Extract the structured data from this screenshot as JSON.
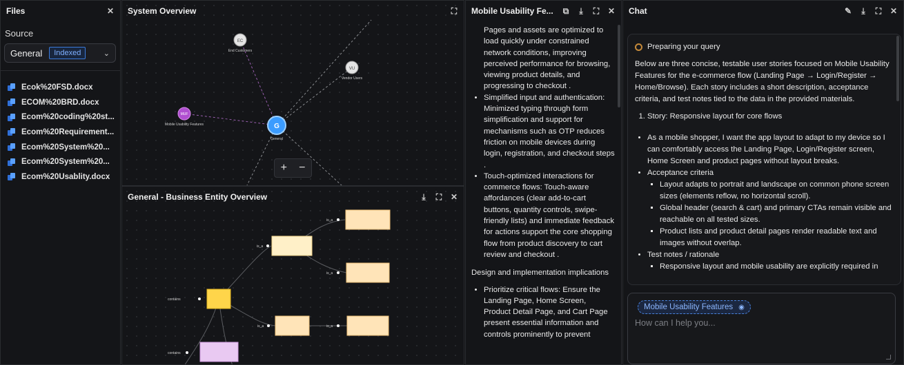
{
  "files_panel": {
    "title": "Files",
    "source_label": "Source",
    "source_value": "General",
    "indexed_badge": "Indexed",
    "files": [
      "Ecok%20FSD.docx",
      "ECOM%20BRD.docx",
      "Ecom%20coding%20st...",
      "Ecom%20Requirement...",
      "Ecom%20System%20...",
      "Ecom%20System%20...",
      "Ecom%20Usablity.docx"
    ]
  },
  "system_overview": {
    "title": "System Overview",
    "nodes": [
      {
        "abbr": "EC",
        "label": "End Customers"
      },
      {
        "abbr": "VU",
        "label": "Vendor Users"
      },
      {
        "abbr": "MUF",
        "label": "Mobile Usability Features"
      },
      {
        "abbr": "G",
        "label": "General"
      }
    ],
    "zoom_in": "+",
    "zoom_out": "−"
  },
  "business_entity": {
    "title": "General - Business Entity Overview",
    "edge_labels": [
      "is_a",
      "is_a",
      "is_a",
      "contains",
      "is_a",
      "is_a",
      "contains"
    ]
  },
  "doc_panel": {
    "title": "Mobile Usability Fe...",
    "intro_continuation": "Pages and assets are optimized to load quickly under constrained network conditions, improving perceived performance for browsing, viewing product details, and progressing to checkout .",
    "bullets": [
      "Simplified input and authentication: Minimized typing through form simplification and support for mechanisms such as OTP reduces friction on mobile devices during login, registration, and checkout steps .",
      "Touch-optimized interactions for commerce flows: Touch-aware affordances (clear add-to-cart buttons, quantity controls, swipe-friendly lists) and immediate feedback for actions support the core shopping flow from product discovery to cart review and checkout ."
    ],
    "section_heading": "Design and implementation implications",
    "section_bullets": [
      "Prioritize critical flows: Ensure the Landing Page, Home Screen, Product Detail Page, and Cart Page present essential information and controls prominently to prevent"
    ]
  },
  "chat": {
    "title": "Chat",
    "status": "Preparing your query",
    "intro": "Below are three concise, testable user stories focused on Mobile Usability Features for the e-commerce flow (Landing Page → Login/Register → Home/Browse). Each story includes a short description, acceptance criteria, and test notes tied to the data in the provided materials.",
    "story_title": "Story: Responsive layout for core flows",
    "story_desc": "As a mobile shopper, I want the app layout to adapt to my device so I can comfortably access the Landing Page, Login/Register screen, Home Screen and product pages without layout breaks.",
    "acceptance_label": "Acceptance criteria",
    "acceptance": [
      "Layout adapts to portrait and landscape on common phone screen sizes (elements reflow, no horizontal scroll).",
      "Global header (search & cart) and primary CTAs remain visible and reachable on all tested sizes.",
      "Product lists and product detail pages render readable text and images without overlap."
    ],
    "test_notes_label": "Test notes / rationale",
    "test_notes": [
      "Responsive layout and mobile usability are explicitly required in"
    ],
    "context_chip": "Mobile Usability Features",
    "input_placeholder": "How can I help you..."
  },
  "colors": {
    "accent_blue": "#3b9cff",
    "muf_purple": "#b04fd0",
    "entity_yellow": "#ffd54a",
    "entity_peach": "#ffe4b8",
    "entity_lilac": "#e9c9f2"
  }
}
